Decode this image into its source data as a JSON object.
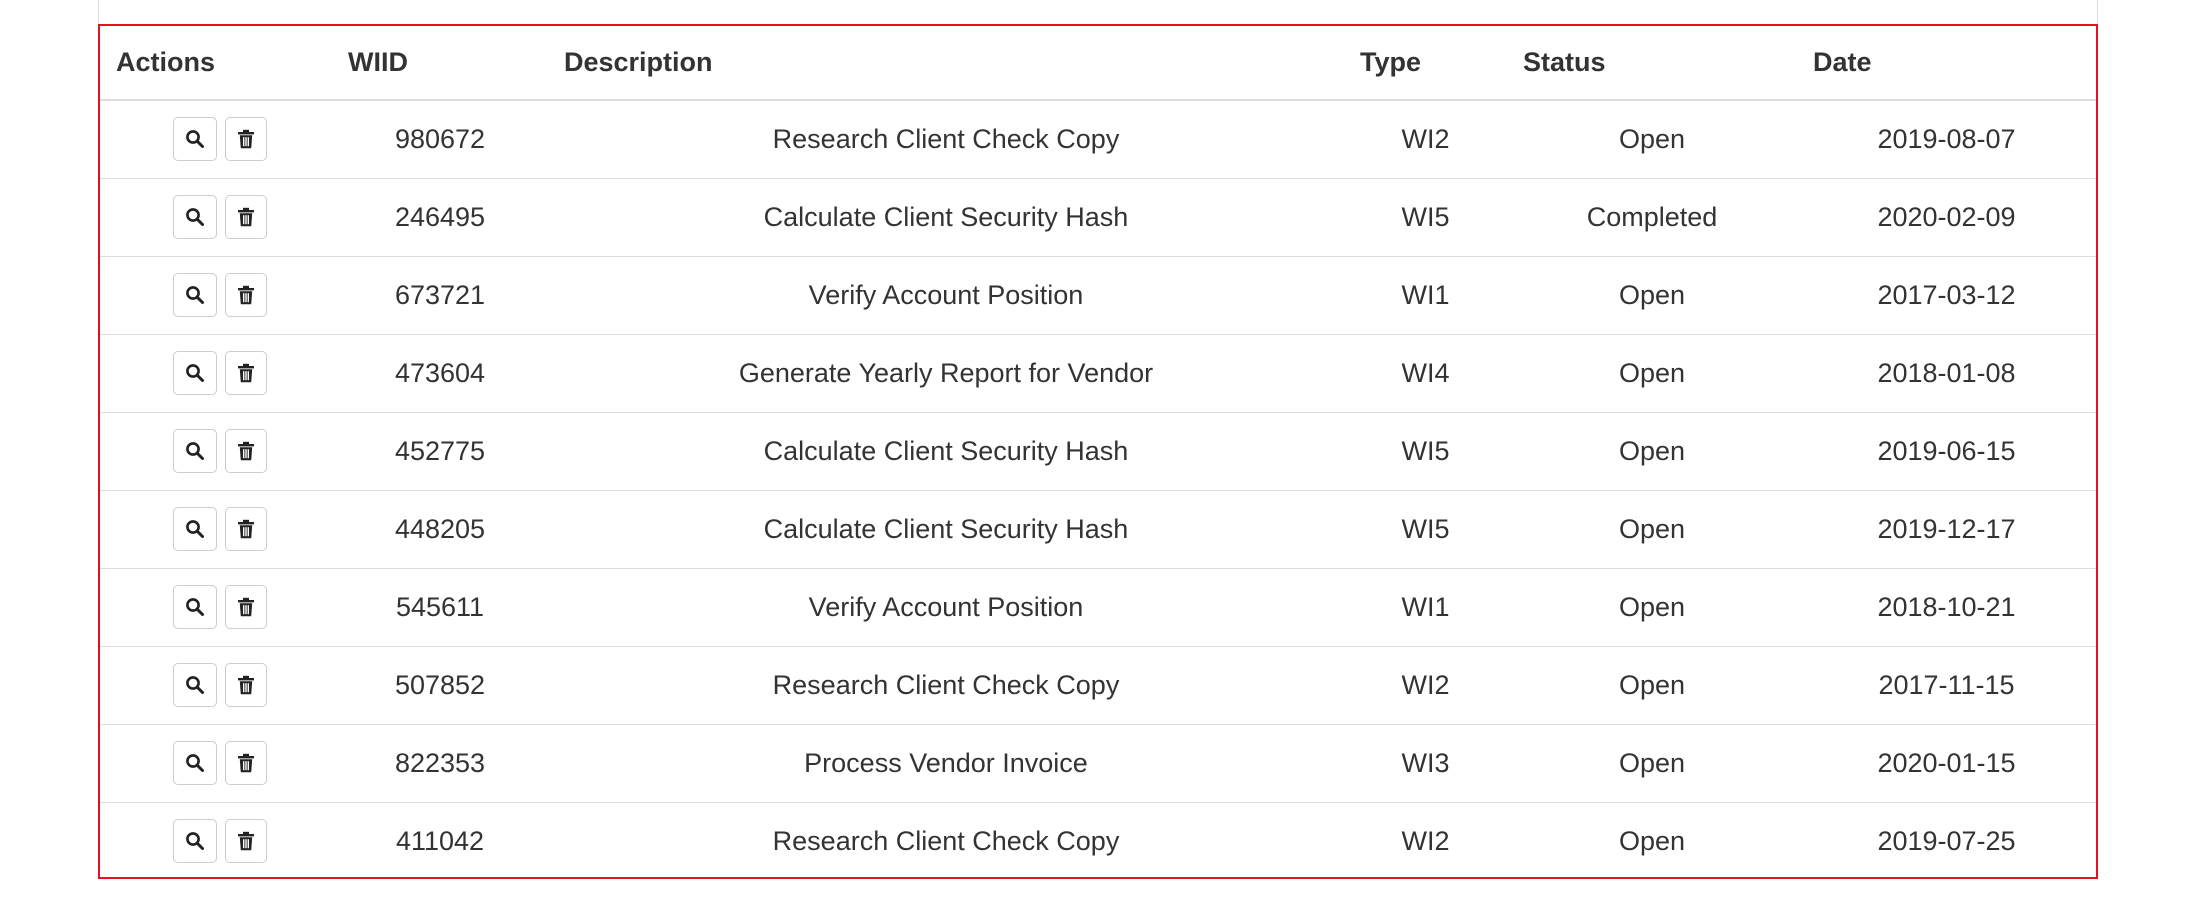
{
  "table": {
    "headers": {
      "actions": "Actions",
      "wiid": "WIID",
      "description": "Description",
      "type": "Type",
      "status": "Status",
      "date": "Date"
    },
    "rows": [
      {
        "wiid": "980672",
        "description": "Research Client Check Copy",
        "type": "WI2",
        "status": "Open",
        "date": "2019-08-07"
      },
      {
        "wiid": "246495",
        "description": "Calculate Client Security Hash",
        "type": "WI5",
        "status": "Completed",
        "date": "2020-02-09"
      },
      {
        "wiid": "673721",
        "description": "Verify Account Position",
        "type": "WI1",
        "status": "Open",
        "date": "2017-03-12"
      },
      {
        "wiid": "473604",
        "description": "Generate Yearly Report for Vendor",
        "type": "WI4",
        "status": "Open",
        "date": "2018-01-08"
      },
      {
        "wiid": "452775",
        "description": "Calculate Client Security Hash",
        "type": "WI5",
        "status": "Open",
        "date": "2019-06-15"
      },
      {
        "wiid": "448205",
        "description": "Calculate Client Security Hash",
        "type": "WI5",
        "status": "Open",
        "date": "2019-12-17"
      },
      {
        "wiid": "545611",
        "description": "Verify Account Position",
        "type": "WI1",
        "status": "Open",
        "date": "2018-10-21"
      },
      {
        "wiid": "507852",
        "description": "Research Client Check Copy",
        "type": "WI2",
        "status": "Open",
        "date": "2017-11-15"
      },
      {
        "wiid": "822353",
        "description": "Process Vendor Invoice",
        "type": "WI3",
        "status": "Open",
        "date": "2020-01-15"
      },
      {
        "wiid": "411042",
        "description": "Research Client Check Copy",
        "type": "WI2",
        "status": "Open",
        "date": "2019-07-25"
      }
    ],
    "row_icons": {
      "view": "search-icon",
      "delete": "trash-icon"
    }
  },
  "colors": {
    "highlight_border": "#e8101f",
    "row_divider": "#dddddd",
    "text": "#333333"
  }
}
